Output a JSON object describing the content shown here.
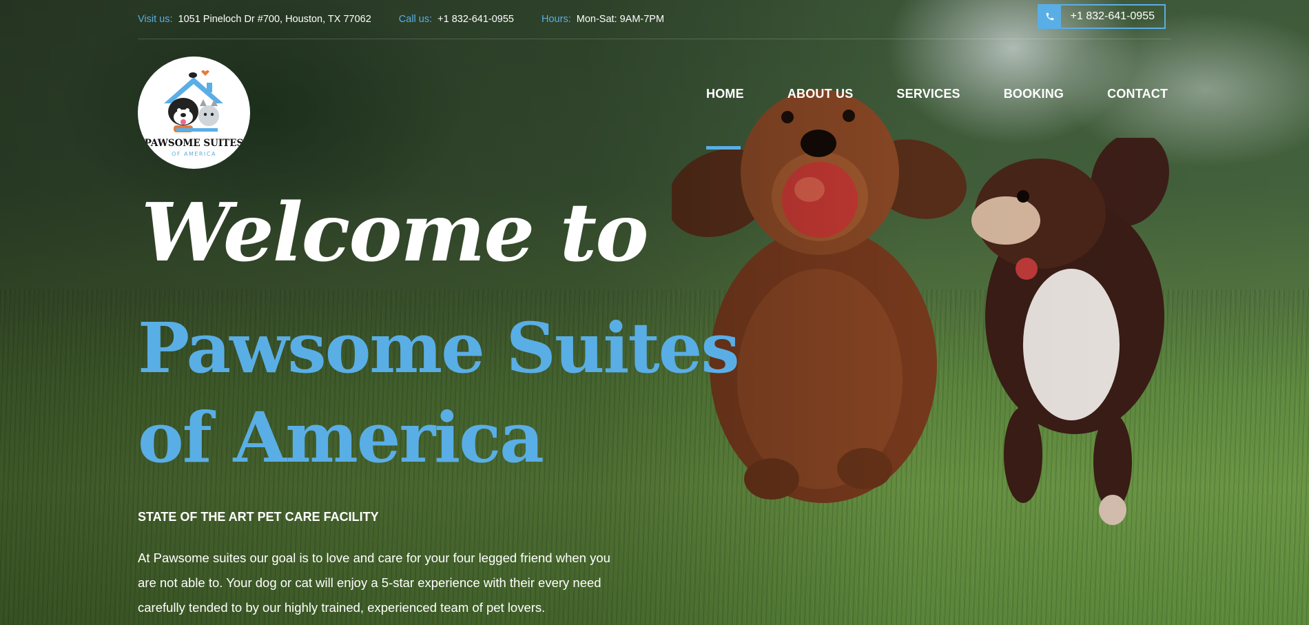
{
  "topbar": {
    "visit_label": "Visit us:",
    "visit_value": "1051 Pineloch Dr #700, Houston, TX 77062",
    "call_label": "Call us:",
    "call_value": "+1 832-641-0955",
    "hours_label": "Hours:",
    "hours_value": "Mon-Sat: 9AM-7PM",
    "phone_button": "+1 832-641-0955"
  },
  "logo": {
    "line1": "PAWSOME SUITES",
    "line2": "OF AMERICA"
  },
  "nav": {
    "items": [
      "HOME",
      "ABOUT US",
      "SERVICES",
      "BOOKING",
      "CONTACT"
    ],
    "active": "HOME"
  },
  "hero": {
    "title_line1": "Welcome to",
    "title_line2": "Pawsome Suites of America",
    "tagline": "STATE OF THE ART PET CARE FACILITY",
    "description": "At Pawsome suites our goal is to love and care for your four legged friend when you are not able to. Your dog or cat will enjoy a 5-star experience with their every need carefully tended to by our highly trained, experienced team of pet lovers."
  },
  "colors": {
    "accent": "#5aaee6",
    "text": "#ffffff"
  },
  "icons": [
    "phone-icon"
  ]
}
